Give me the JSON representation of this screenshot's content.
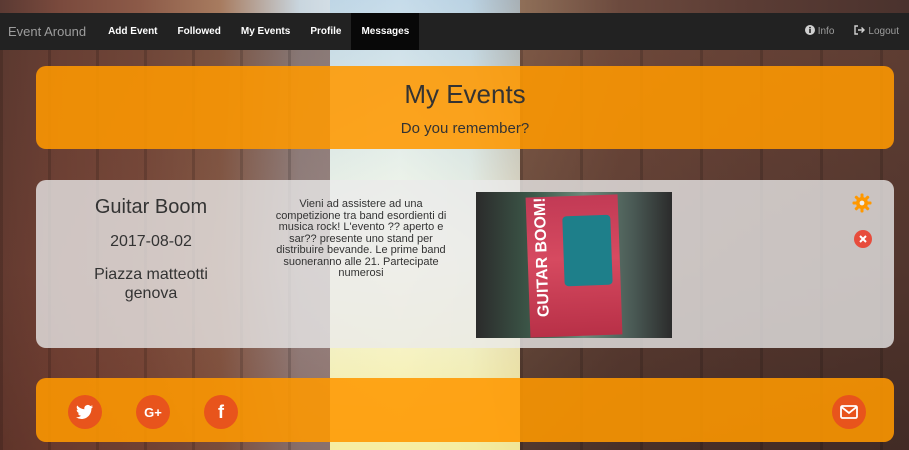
{
  "navbar": {
    "brand": "Event Around",
    "items": [
      {
        "label": "Add Event"
      },
      {
        "label": "Followed"
      },
      {
        "label": "My Events"
      },
      {
        "label": "Profile"
      },
      {
        "label": "Messages"
      }
    ],
    "right": {
      "info_label": "Info",
      "logout_label": "Logout"
    }
  },
  "header": {
    "title": "My Events",
    "subtitle": "Do you remember?"
  },
  "event": {
    "name": "Guitar Boom",
    "date": "2017-08-02",
    "place_line1": "Piazza matteotti",
    "place_line2": "genova",
    "description": "Vieni ad assistere ad una competizione tra band esordienti di musica rock! L'evento ?? aperto e sar?? presente uno stand per distribuire bevande. Le prime band suoneranno alle 21. Partecipate numerosi",
    "poster_text": "GUITAR BOOM!"
  },
  "footer": {
    "social": [
      {
        "icon": "twitter-icon",
        "glyph": "t"
      },
      {
        "icon": "google-plus-icon",
        "glyph": "G+"
      },
      {
        "icon": "facebook-icon",
        "glyph": "f"
      }
    ],
    "mail_icon": "mail-icon"
  },
  "colors": {
    "accent": "#ff9800",
    "social": "#e8541c",
    "navbar": "#222222",
    "danger": "#e74c3c"
  }
}
